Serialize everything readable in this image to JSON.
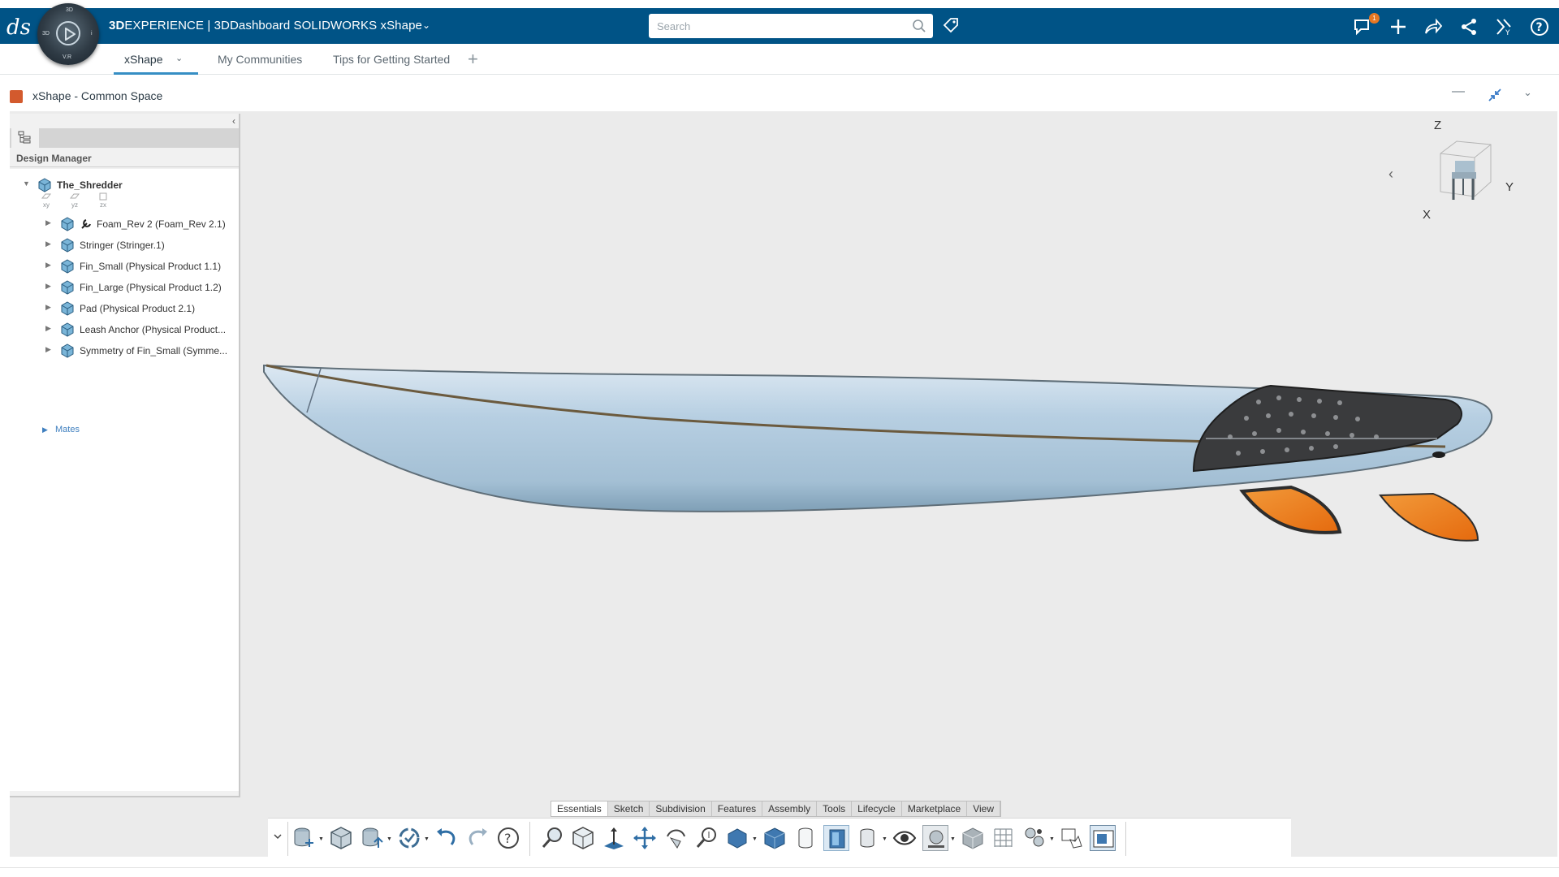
{
  "topbar": {
    "brand_bold": "3D",
    "brand_rest": "EXPERIENCE | 3DDashboard  SOLIDWORKS xShape",
    "search_placeholder": "Search",
    "notification_count": "1",
    "compass_labels": {
      "top": "3D",
      "left": "3D",
      "right": "i",
      "bottom": "V.R"
    }
  },
  "tabs": [
    {
      "label": "xShape",
      "active": true
    },
    {
      "label": "My Communities"
    },
    {
      "label": "Tips for Getting Started"
    }
  ],
  "widget": {
    "title": "xShape - Common Space"
  },
  "design_manager": {
    "title": "Design Manager",
    "root": "The_Shredder",
    "planes": [
      "xy",
      "yz",
      "zx"
    ],
    "items": [
      {
        "label": "Foam_Rev 2 (Foam_Rev 2.1)"
      },
      {
        "label": "Stringer (Stringer.1)"
      },
      {
        "label": "Fin_Small (Physical Product 1.1)"
      },
      {
        "label": "Fin_Large (Physical Product 1.2)"
      },
      {
        "label": "Pad (Physical Product 2.1)"
      },
      {
        "label": "Leash Anchor (Physical Product..."
      },
      {
        "label": "Symmetry of Fin_Small (Symme..."
      }
    ],
    "mates": "Mates"
  },
  "triad": {
    "z": "Z",
    "y": "Y",
    "x": "X"
  },
  "command_tabs": [
    "Essentials",
    "Sketch",
    "Subdivision",
    "Features",
    "Assembly",
    "Tools",
    "Lifecycle",
    "Marketplace",
    "View"
  ],
  "colors": {
    "topbar": "#005386",
    "accent": "#368ec4",
    "board": "#b9d0e2",
    "fin": "#f07a1a",
    "pad": "#3a3b3d"
  }
}
